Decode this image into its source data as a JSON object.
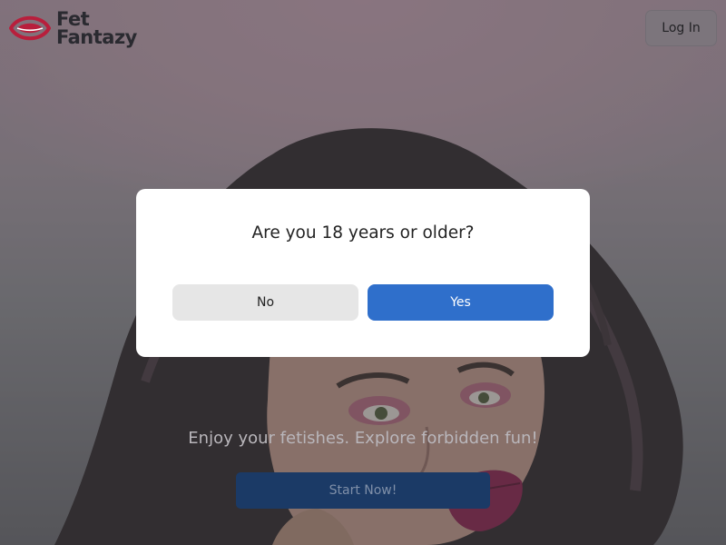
{
  "header": {
    "logo_line1": "Fet",
    "logo_line2": "Fantazy",
    "login_label": "Log In"
  },
  "hero": {
    "tagline": "Enjoy your fetishes. Explore forbidden fun!",
    "cta_label": "Start Now!"
  },
  "modal": {
    "question": "Are you 18 years or older?",
    "no_label": "No",
    "yes_label": "Yes"
  },
  "colors": {
    "brand_red": "#b81f3c",
    "primary_blue": "#2f6fcb",
    "cta_blue_dimmed": "#1b3a66"
  },
  "icons": {
    "logo": "eye-lips-icon"
  }
}
